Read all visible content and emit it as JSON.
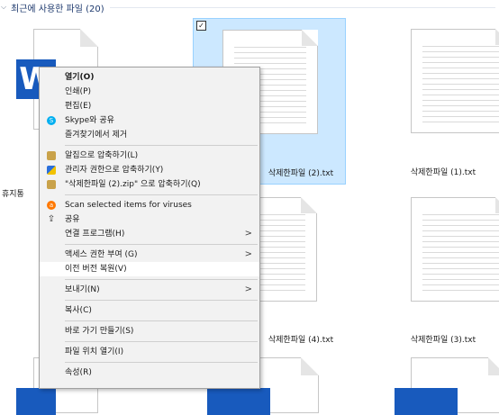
{
  "group": {
    "title": "최근에 사용한 파일 (20)"
  },
  "files": {
    "word_left_label": "휴지통",
    "selected_label": "삭제한파일 (2).txt",
    "right_top_label": "삭제한파일 (1).txt",
    "middle_label": "삭제한파일 (4).txt",
    "right_mid_label": "삭제한파일 (3).txt"
  },
  "menu": {
    "open": "열기(O)",
    "print": "인쇄(P)",
    "edit": "편집(E)",
    "skype_share": "Skype와 공유",
    "remove_favorites": "즐겨찾기에서 제거",
    "alzip_compress": "알집으로 압축하기(L)",
    "admin_compress": "관리자 권한으로 압축하기(Y)",
    "zip_named": "\"삭제한파일 (2).zip\" 으로 압축하기(Q)",
    "scan_viruses": "Scan selected items for viruses",
    "share": "공유",
    "open_with": "연결 프로그램(H)",
    "grant_access": "액세스 권한 부여 (G)",
    "restore_previous": "이전 버전 복원(V)",
    "send_to": "보내기(N)",
    "copy": "복사(C)",
    "create_shortcut": "바로 가기 만들기(S)",
    "open_location": "파일 위치 열기(I)",
    "properties": "속성(R)"
  },
  "icons": {
    "skype": "skype-icon",
    "alzip": "alzip-icon",
    "admin": "admin-shield-icon",
    "zip": "zip-icon",
    "avast": "avast-icon",
    "share": "share-icon"
  },
  "colors": {
    "selection_bg": "#cce8ff",
    "word_blue": "#185abd",
    "skype_blue": "#00aff0",
    "avast_orange": "#ff7800"
  }
}
